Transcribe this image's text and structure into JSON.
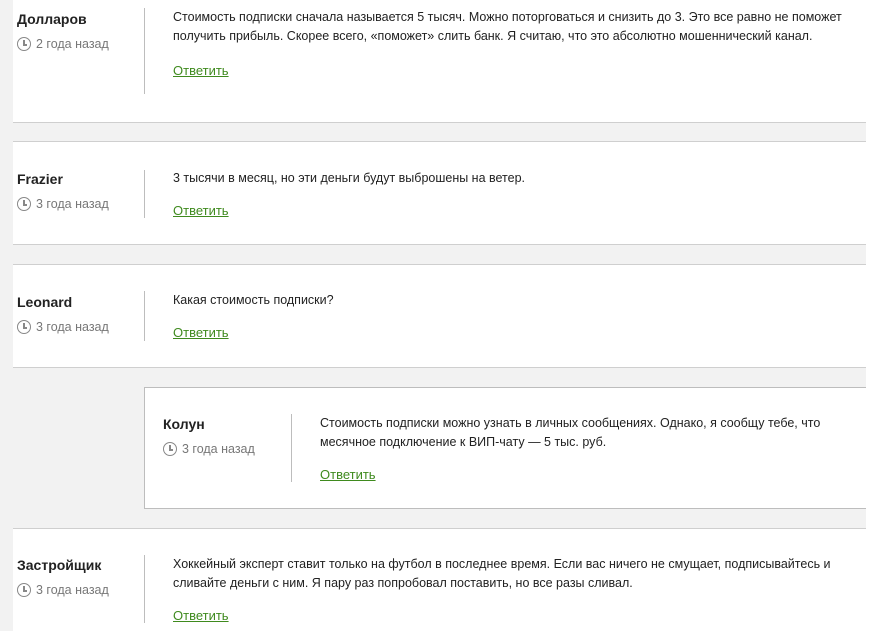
{
  "comments": [
    {
      "author": "Долларов",
      "time": "2 года назад",
      "text": "Стоимость подписки сначала называется 5 тысяч. Можно поторговаться и снизить до 3. Это все равно не поможет получить прибыль. Скорее всего, «поможет» слить банк. Я считаю, что это абсолютно мошеннический канал.",
      "reply_label": "Ответить"
    },
    {
      "author": "Frazier",
      "time": "3 года назад",
      "text": "3 тысячи в месяц, но эти деньги будут выброшены на ветер.",
      "reply_label": "Ответить"
    },
    {
      "author": "Leonard",
      "time": "3 года назад",
      "text": "Какая стоимость подписки?",
      "reply_label": "Ответить"
    },
    {
      "author": "Колун",
      "time": "3 года назад",
      "text": "Стоимость подписки можно узнать в личных сообщениях. Однако, я сообщу тебе, что месячное подключение к ВИП-чату — 5 тыс. руб.",
      "reply_label": "Ответить"
    },
    {
      "author": "Застройщик",
      "time": "3 года назад",
      "text": "Хоккейный эксперт ставит только на футбол в последнее время. Если вас ничего не смущает, подписывайтесь и сливайте деньги с ним. Я пару раз попробовал поставить, но все разы сливал.",
      "reply_label": "Ответить"
    }
  ],
  "icons": {
    "time": "clock-icon"
  },
  "colors": {
    "link": "#3f8a1e",
    "background": "#f2f2f2",
    "divider": "#bdbdbd"
  }
}
